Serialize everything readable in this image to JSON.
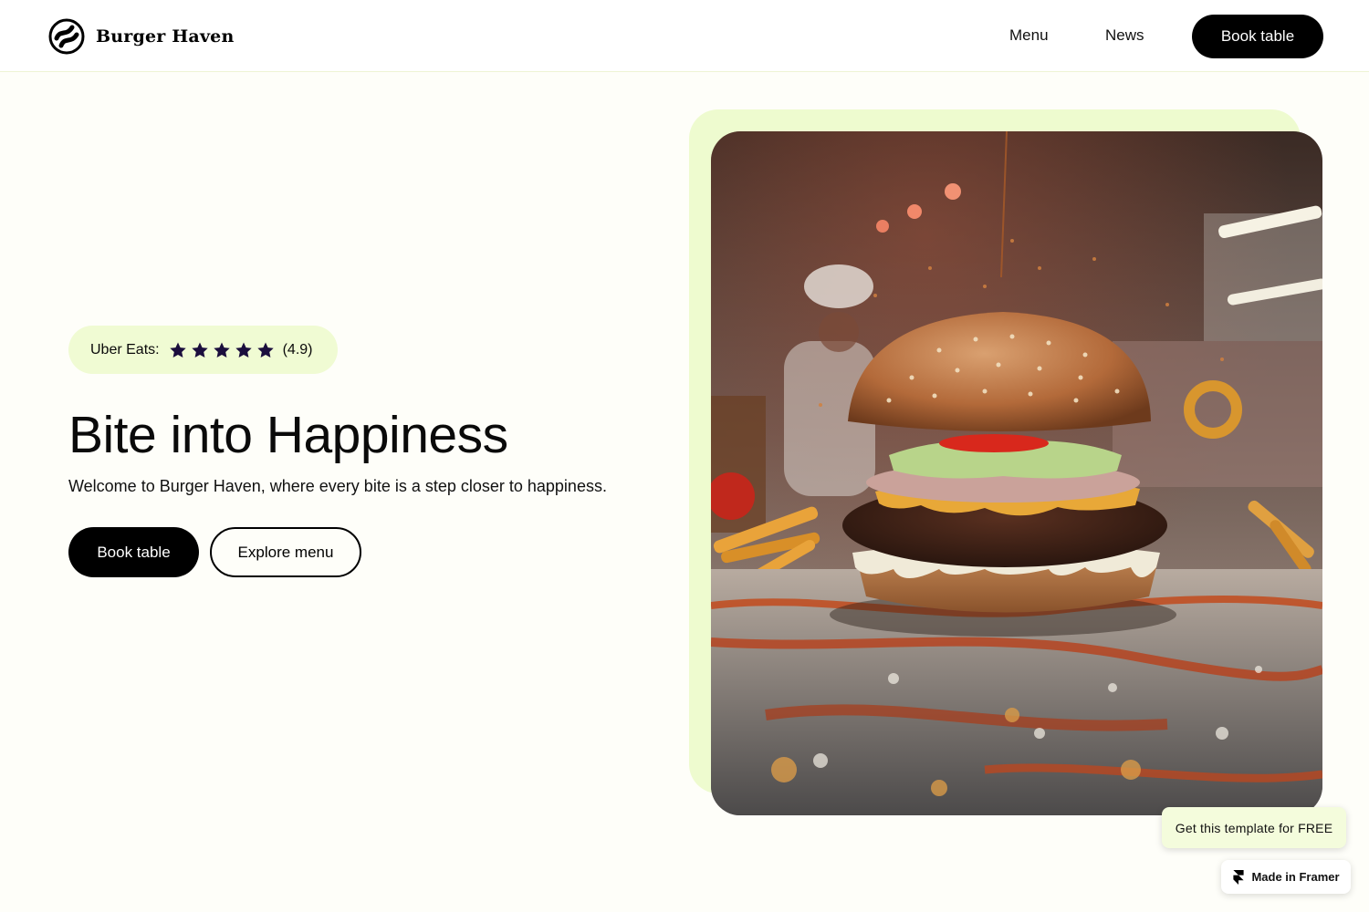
{
  "header": {
    "brand": "Burger Haven",
    "nav": [
      {
        "label": "Menu"
      },
      {
        "label": "News"
      }
    ],
    "cta_label": "Book table"
  },
  "hero": {
    "rating": {
      "source": "Uber Eats:",
      "stars": 5,
      "score": "(4.9)"
    },
    "title": "Bite into Happiness",
    "subtitle": "Welcome to Burger Haven, where every bite is a step closer to happiness.",
    "primary_button": "Book table",
    "secondary_button": "Explore menu"
  },
  "badges": {
    "template": "Get this template for FREE",
    "framer": "Made in Framer"
  },
  "colors": {
    "page_background": "#fefef9",
    "accent_lime": "#eefbcf",
    "button_black": "#000000",
    "star": "#1b0e3d"
  },
  "icons": {
    "logo": "stripes-circle-logo-icon",
    "rating": "star-icon",
    "framer": "framer-icon"
  }
}
